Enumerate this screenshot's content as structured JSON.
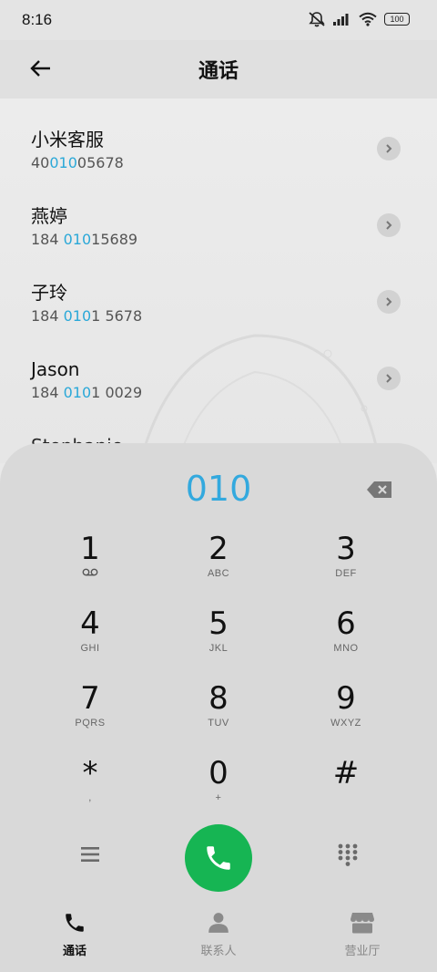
{
  "status": {
    "time": "8:16",
    "battery": "100"
  },
  "header": {
    "title": "通话"
  },
  "contacts": [
    {
      "name": "小米客服",
      "num_pre": "40",
      "num_hl": "010",
      "num_post": "05678"
    },
    {
      "name": "燕婷",
      "num_pre": "184 ",
      "num_hl": "010",
      "num_post": "15689"
    },
    {
      "name": "子玲",
      "num_pre": "184 ",
      "num_hl": "010",
      "num_post": "1 5678"
    },
    {
      "name": "Jason",
      "num_pre": "184 ",
      "num_hl": "010",
      "num_post": "1 0029"
    },
    {
      "name": "Stephanie"
    }
  ],
  "dialer": {
    "digits": "010",
    "keys": [
      {
        "digit": "1",
        "letters": ""
      },
      {
        "digit": "2",
        "letters": "ABC"
      },
      {
        "digit": "3",
        "letters": "DEF"
      },
      {
        "digit": "4",
        "letters": "GHI"
      },
      {
        "digit": "5",
        "letters": "JKL"
      },
      {
        "digit": "6",
        "letters": "MNO"
      },
      {
        "digit": "7",
        "letters": "PQRS"
      },
      {
        "digit": "8",
        "letters": "TUV"
      },
      {
        "digit": "9",
        "letters": "WXYZ"
      },
      {
        "digit": "*",
        "letters": ","
      },
      {
        "digit": "0",
        "letters": "+"
      },
      {
        "digit": "#",
        "letters": ""
      }
    ]
  },
  "tabs": [
    {
      "label": "通话",
      "icon": "phone-icon",
      "active": true
    },
    {
      "label": "联系人",
      "icon": "person-icon",
      "active": false
    },
    {
      "label": "营业厅",
      "icon": "store-icon",
      "active": false
    }
  ],
  "colors": {
    "accent": "#33a9de",
    "call_green": "#16b553"
  }
}
